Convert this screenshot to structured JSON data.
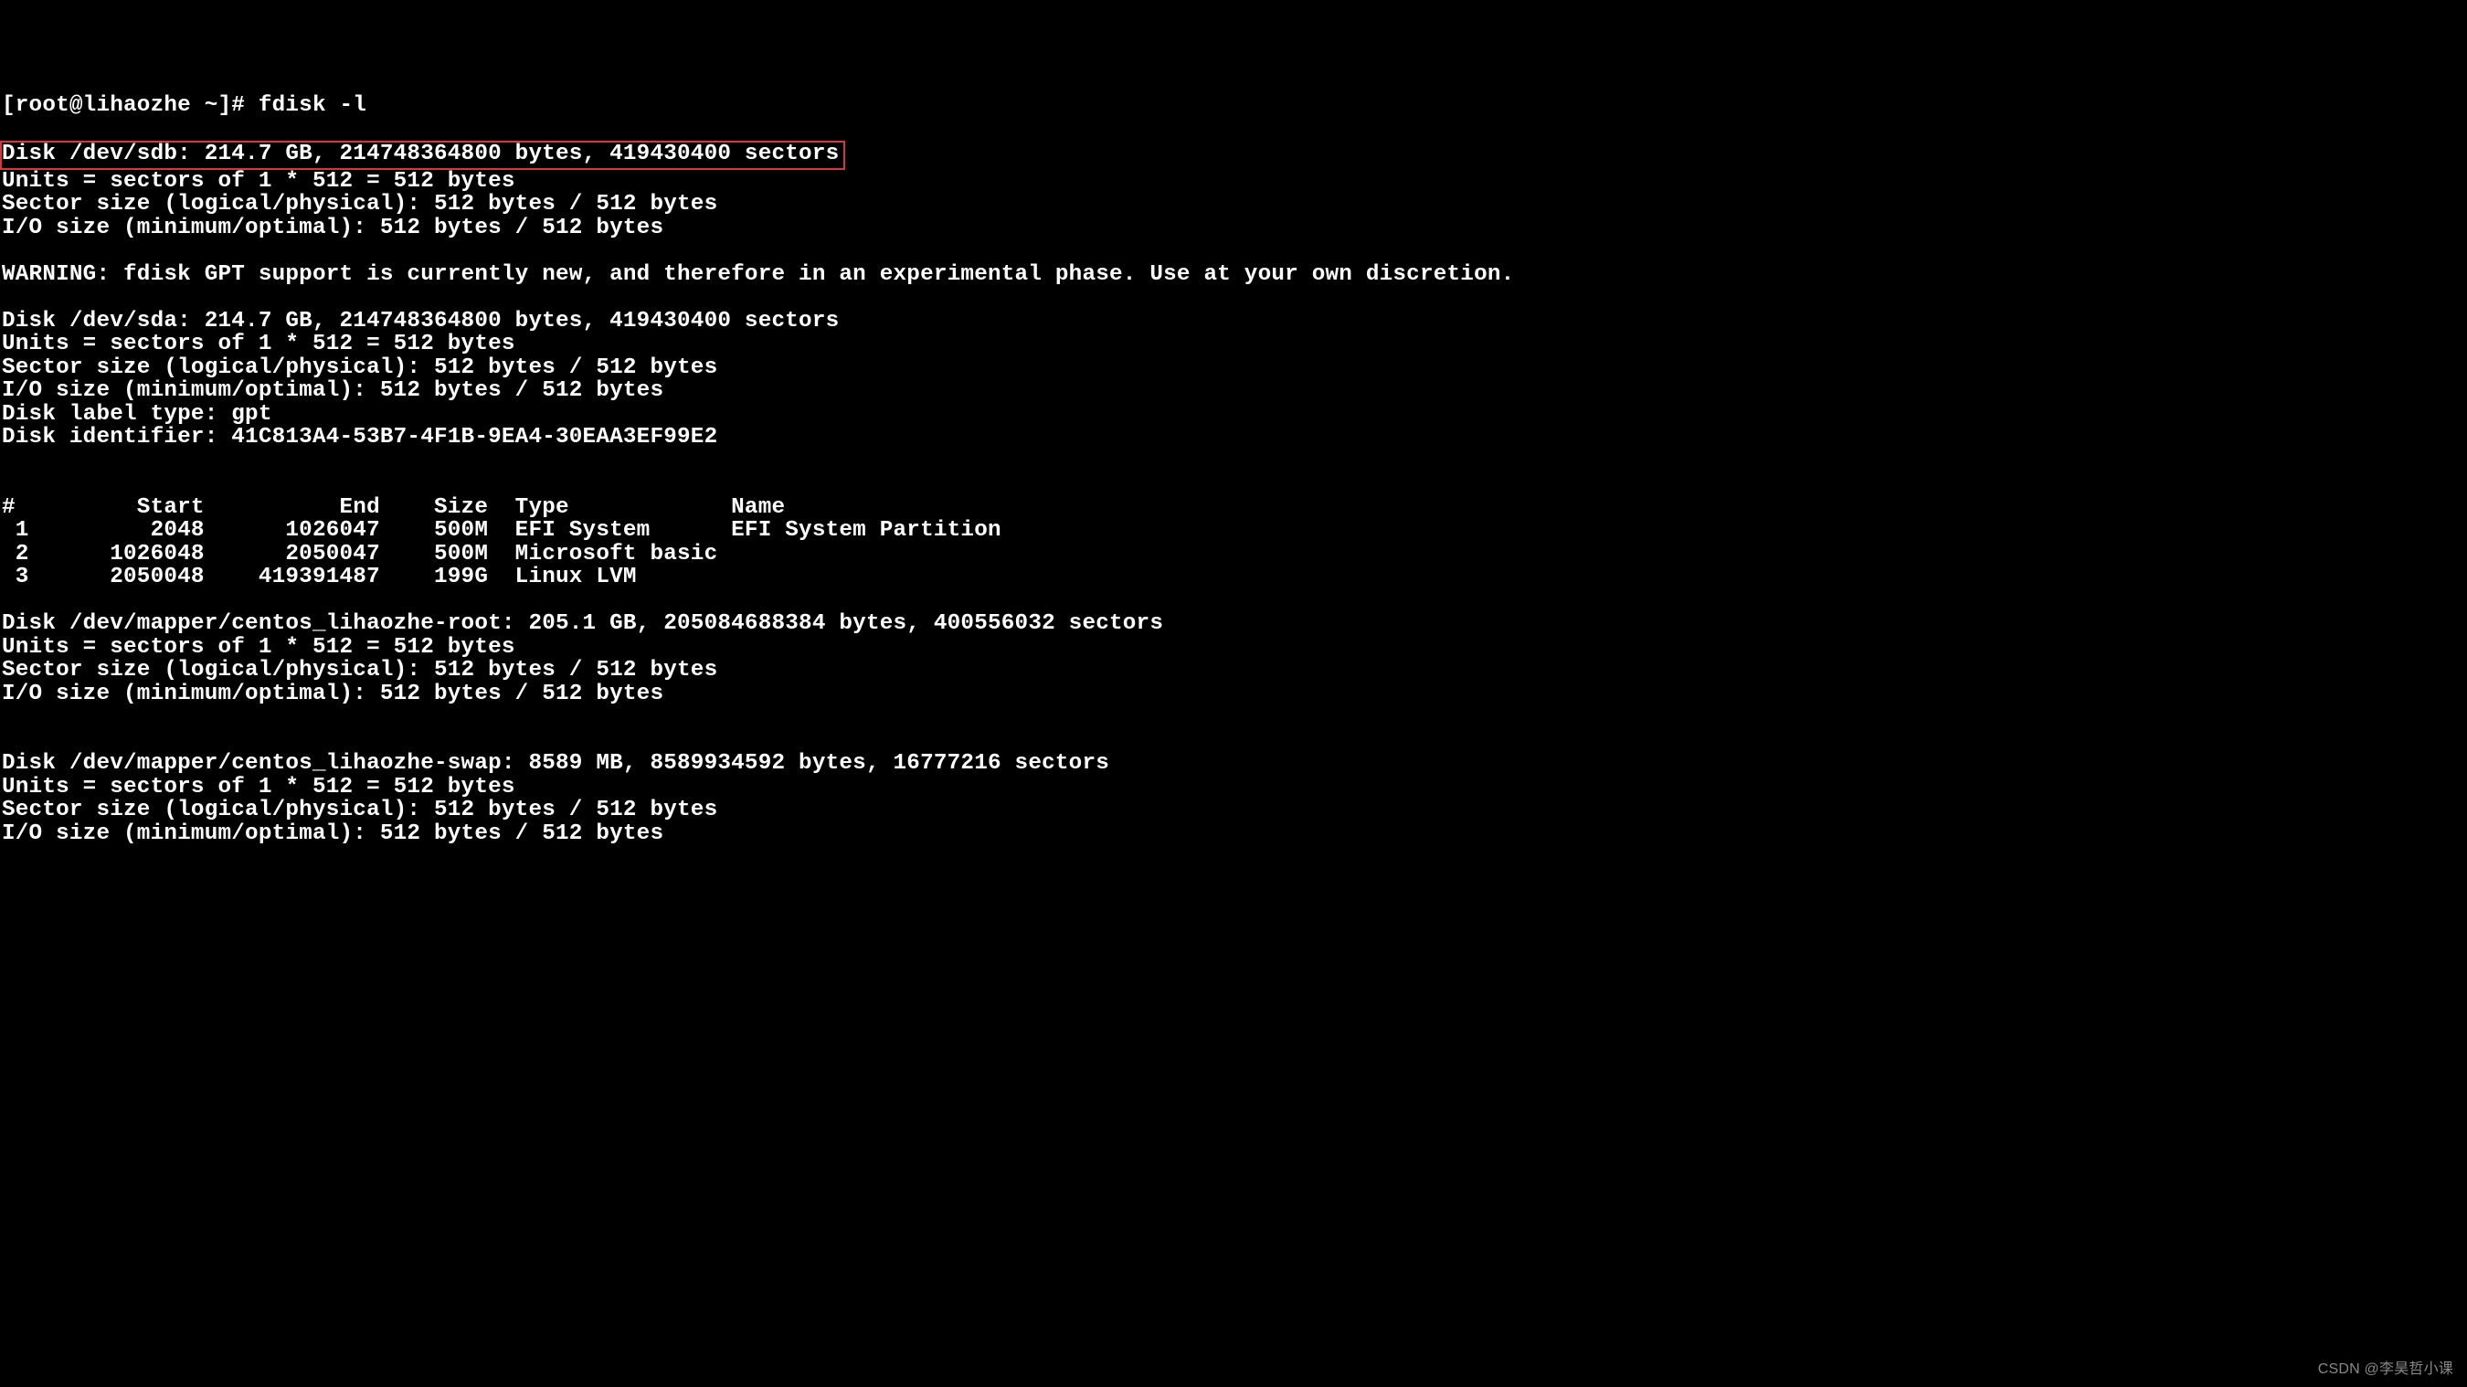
{
  "prompt": "[root@lihaozhe ~]# fdisk -l",
  "highlighted_line": "Disk /dev/sdb: 214.7 GB, 214748364800 bytes, 419430400 sectors",
  "sdb_block": {
    "units": "Units = sectors of 1 * 512 = 512 bytes",
    "sector_size": "Sector size (logical/physical): 512 bytes / 512 bytes",
    "io_size": "I/O size (minimum/optimal): 512 bytes / 512 bytes"
  },
  "warning": "WARNING: fdisk GPT support is currently new, and therefore in an experimental phase. Use at your own discretion.",
  "sda_block": {
    "disk": "Disk /dev/sda: 214.7 GB, 214748364800 bytes, 419430400 sectors",
    "units": "Units = sectors of 1 * 512 = 512 bytes",
    "sector_size": "Sector size (logical/physical): 512 bytes / 512 bytes",
    "io_size": "I/O size (minimum/optimal): 512 bytes / 512 bytes",
    "label_type": "Disk label type: gpt",
    "identifier": "Disk identifier: 41C813A4-53B7-4F1B-9EA4-30EAA3EF99E2"
  },
  "partition_header": "#         Start          End    Size  Type            Name",
  "partitions": [
    " 1         2048      1026047    500M  EFI System      EFI System Partition",
    " 2      1026048      2050047    500M  Microsoft basic ",
    " 3      2050048    419391487    199G  Linux LVM       "
  ],
  "mapper_root": {
    "disk": "Disk /dev/mapper/centos_lihaozhe-root: 205.1 GB, 205084688384 bytes, 400556032 sectors",
    "units": "Units = sectors of 1 * 512 = 512 bytes",
    "sector_size": "Sector size (logical/physical): 512 bytes / 512 bytes",
    "io_size": "I/O size (minimum/optimal): 512 bytes / 512 bytes"
  },
  "mapper_swap": {
    "disk": "Disk /dev/mapper/centos_lihaozhe-swap: 8589 MB, 8589934592 bytes, 16777216 sectors",
    "units": "Units = sectors of 1 * 512 = 512 bytes",
    "sector_size": "Sector size (logical/physical): 512 bytes / 512 bytes",
    "io_size": "I/O size (minimum/optimal): 512 bytes / 512 bytes"
  },
  "watermark": "CSDN @李昊哲小课"
}
